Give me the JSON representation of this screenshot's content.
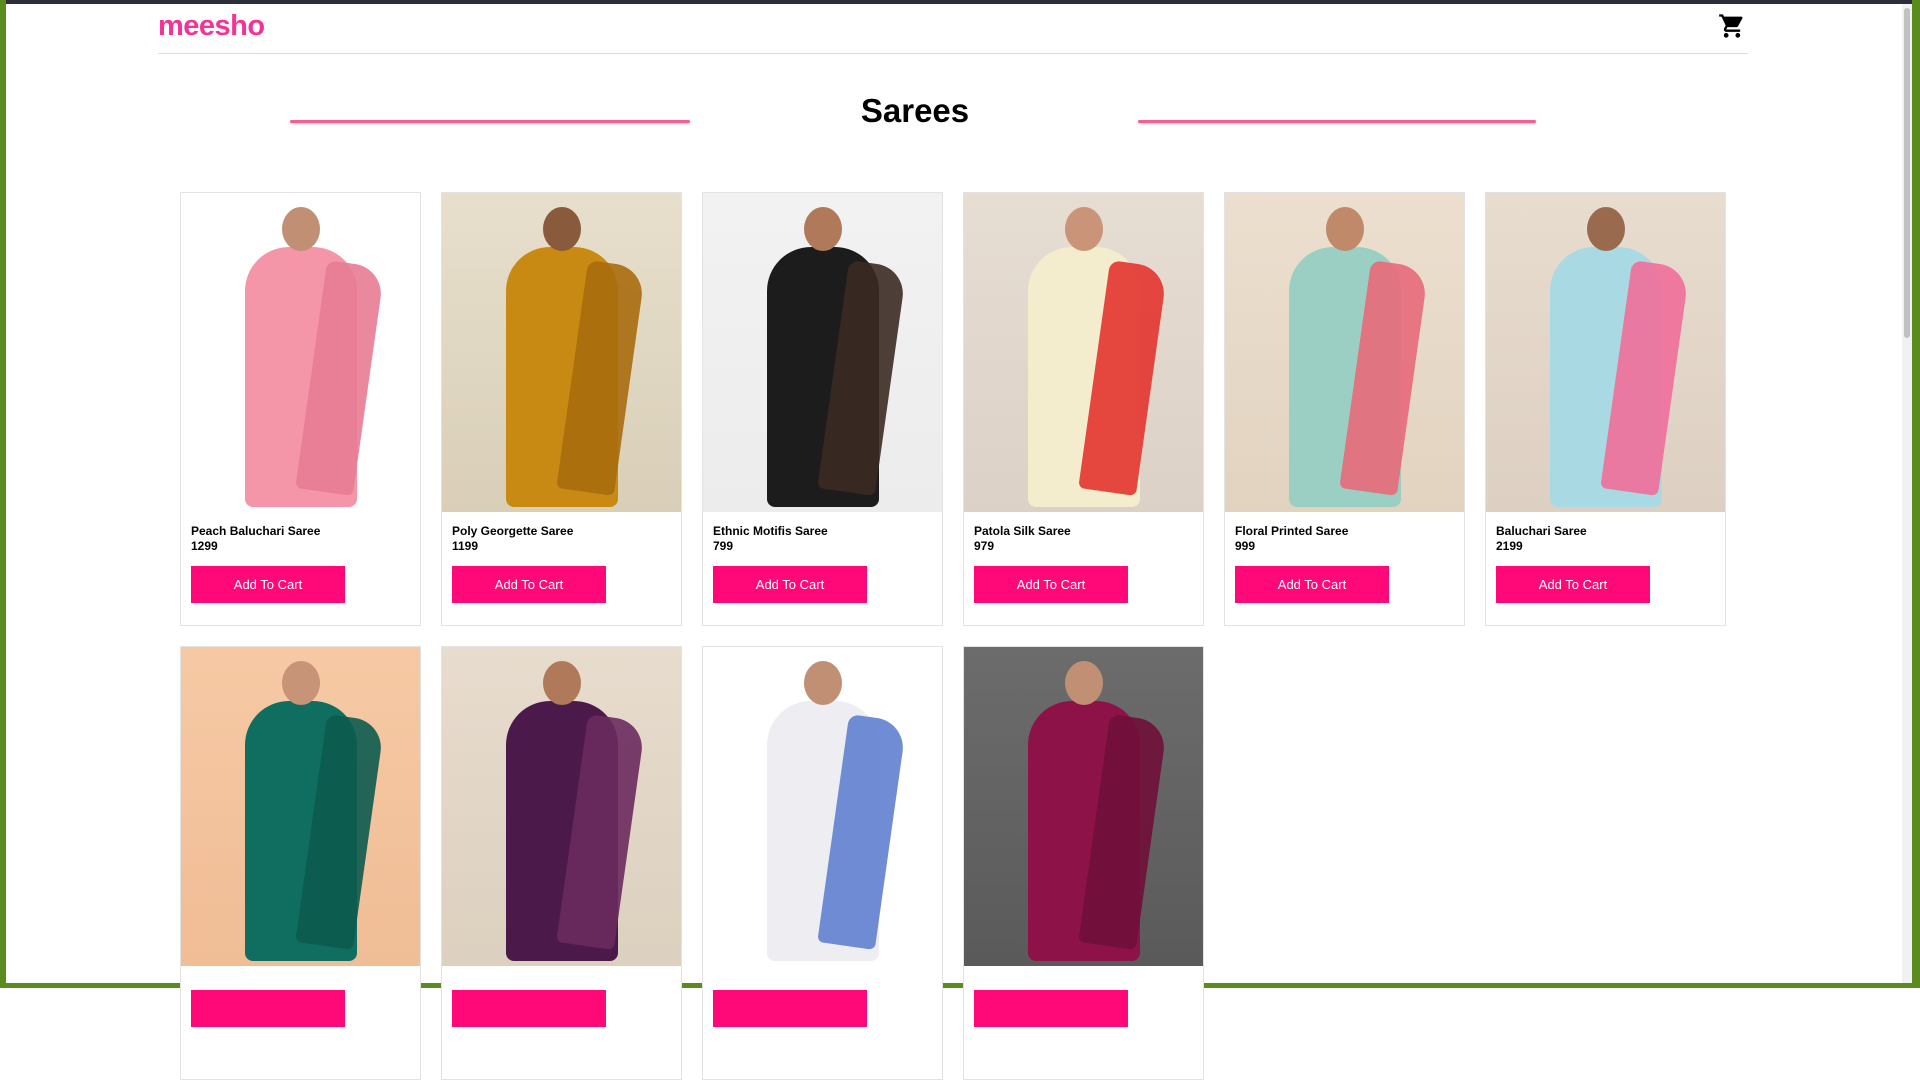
{
  "brand": {
    "logo_text": "meesho"
  },
  "header": {
    "cart_icon": "shopping-cart-icon"
  },
  "page": {
    "title": "Sarees"
  },
  "colors": {
    "brand": "#f43397",
    "button": "#ff0878",
    "divider": "#f06292"
  },
  "products": [
    {
      "name": "Peach Baluchari Saree",
      "price": "1299",
      "button_label": "Add To Cart",
      "bg1": "#ffffff",
      "bg2": "#ffffff",
      "skin": "#c08f74",
      "saree": "#f596a8",
      "pallu": "#e87c93"
    },
    {
      "name": "Poly Georgette Saree",
      "price": "1199",
      "button_label": "Add To Cart",
      "bg1": "#e7dfcc",
      "bg2": "#d9cfb8",
      "skin": "#8a5a3c",
      "saree": "#c98a14",
      "pallu": "#a86b0c"
    },
    {
      "name": "Ethnic Motifis Saree",
      "price": "799",
      "button_label": "Add To Cart",
      "bg1": "#f2f2f2",
      "bg2": "#ececec",
      "skin": "#b07a5a",
      "saree": "#1c1c1c",
      "pallu": "#3b2a22"
    },
    {
      "name": "Patola Silk Saree",
      "price": "979",
      "button_label": "Add To Cart",
      "bg1": "#e6ddd3",
      "bg2": "#dcd1c6",
      "skin": "#c99478",
      "saree": "#f3eccd",
      "pallu": "#e3342f"
    },
    {
      "name": "Floral Printed Saree",
      "price": "999",
      "button_label": "Add To Cart",
      "bg1": "#ecdfcf",
      "bg2": "#e2d3c0",
      "skin": "#c0896a",
      "saree": "#9ccfc4",
      "pallu": "#e8697a"
    },
    {
      "name": "Baluchari Saree",
      "price": "2199",
      "button_label": "Add To Cart",
      "bg1": "#e8dccf",
      "bg2": "#ddd0c2",
      "skin": "#9a6a4e",
      "saree": "#a9d9e2",
      "pallu": "#f06e9a"
    },
    {
      "name": "",
      "price": "",
      "button_label": "",
      "bg1": "#f6c9a4",
      "bg2": "#efbd96",
      "skin": "#c89478",
      "saree": "#0f6e60",
      "pallu": "#0c5a4f"
    },
    {
      "name": "",
      "price": "",
      "button_label": "",
      "bg1": "#e7dccd",
      "bg2": "#dcd0bf",
      "skin": "#b07a5a",
      "saree": "#4b1a4b",
      "pallu": "#6a2a5e"
    },
    {
      "name": "",
      "price": "",
      "button_label": "",
      "bg1": "#ffffff",
      "bg2": "#ffffff",
      "skin": "#c08f74",
      "saree": "#eeeef2",
      "pallu": "#5f7fd0"
    },
    {
      "name": "",
      "price": "",
      "button_label": "",
      "bg1": "#6c6c6c",
      "bg2": "#5a5a5a",
      "skin": "#c08f74",
      "saree": "#8c1248",
      "pallu": "#6f0f3a"
    }
  ]
}
